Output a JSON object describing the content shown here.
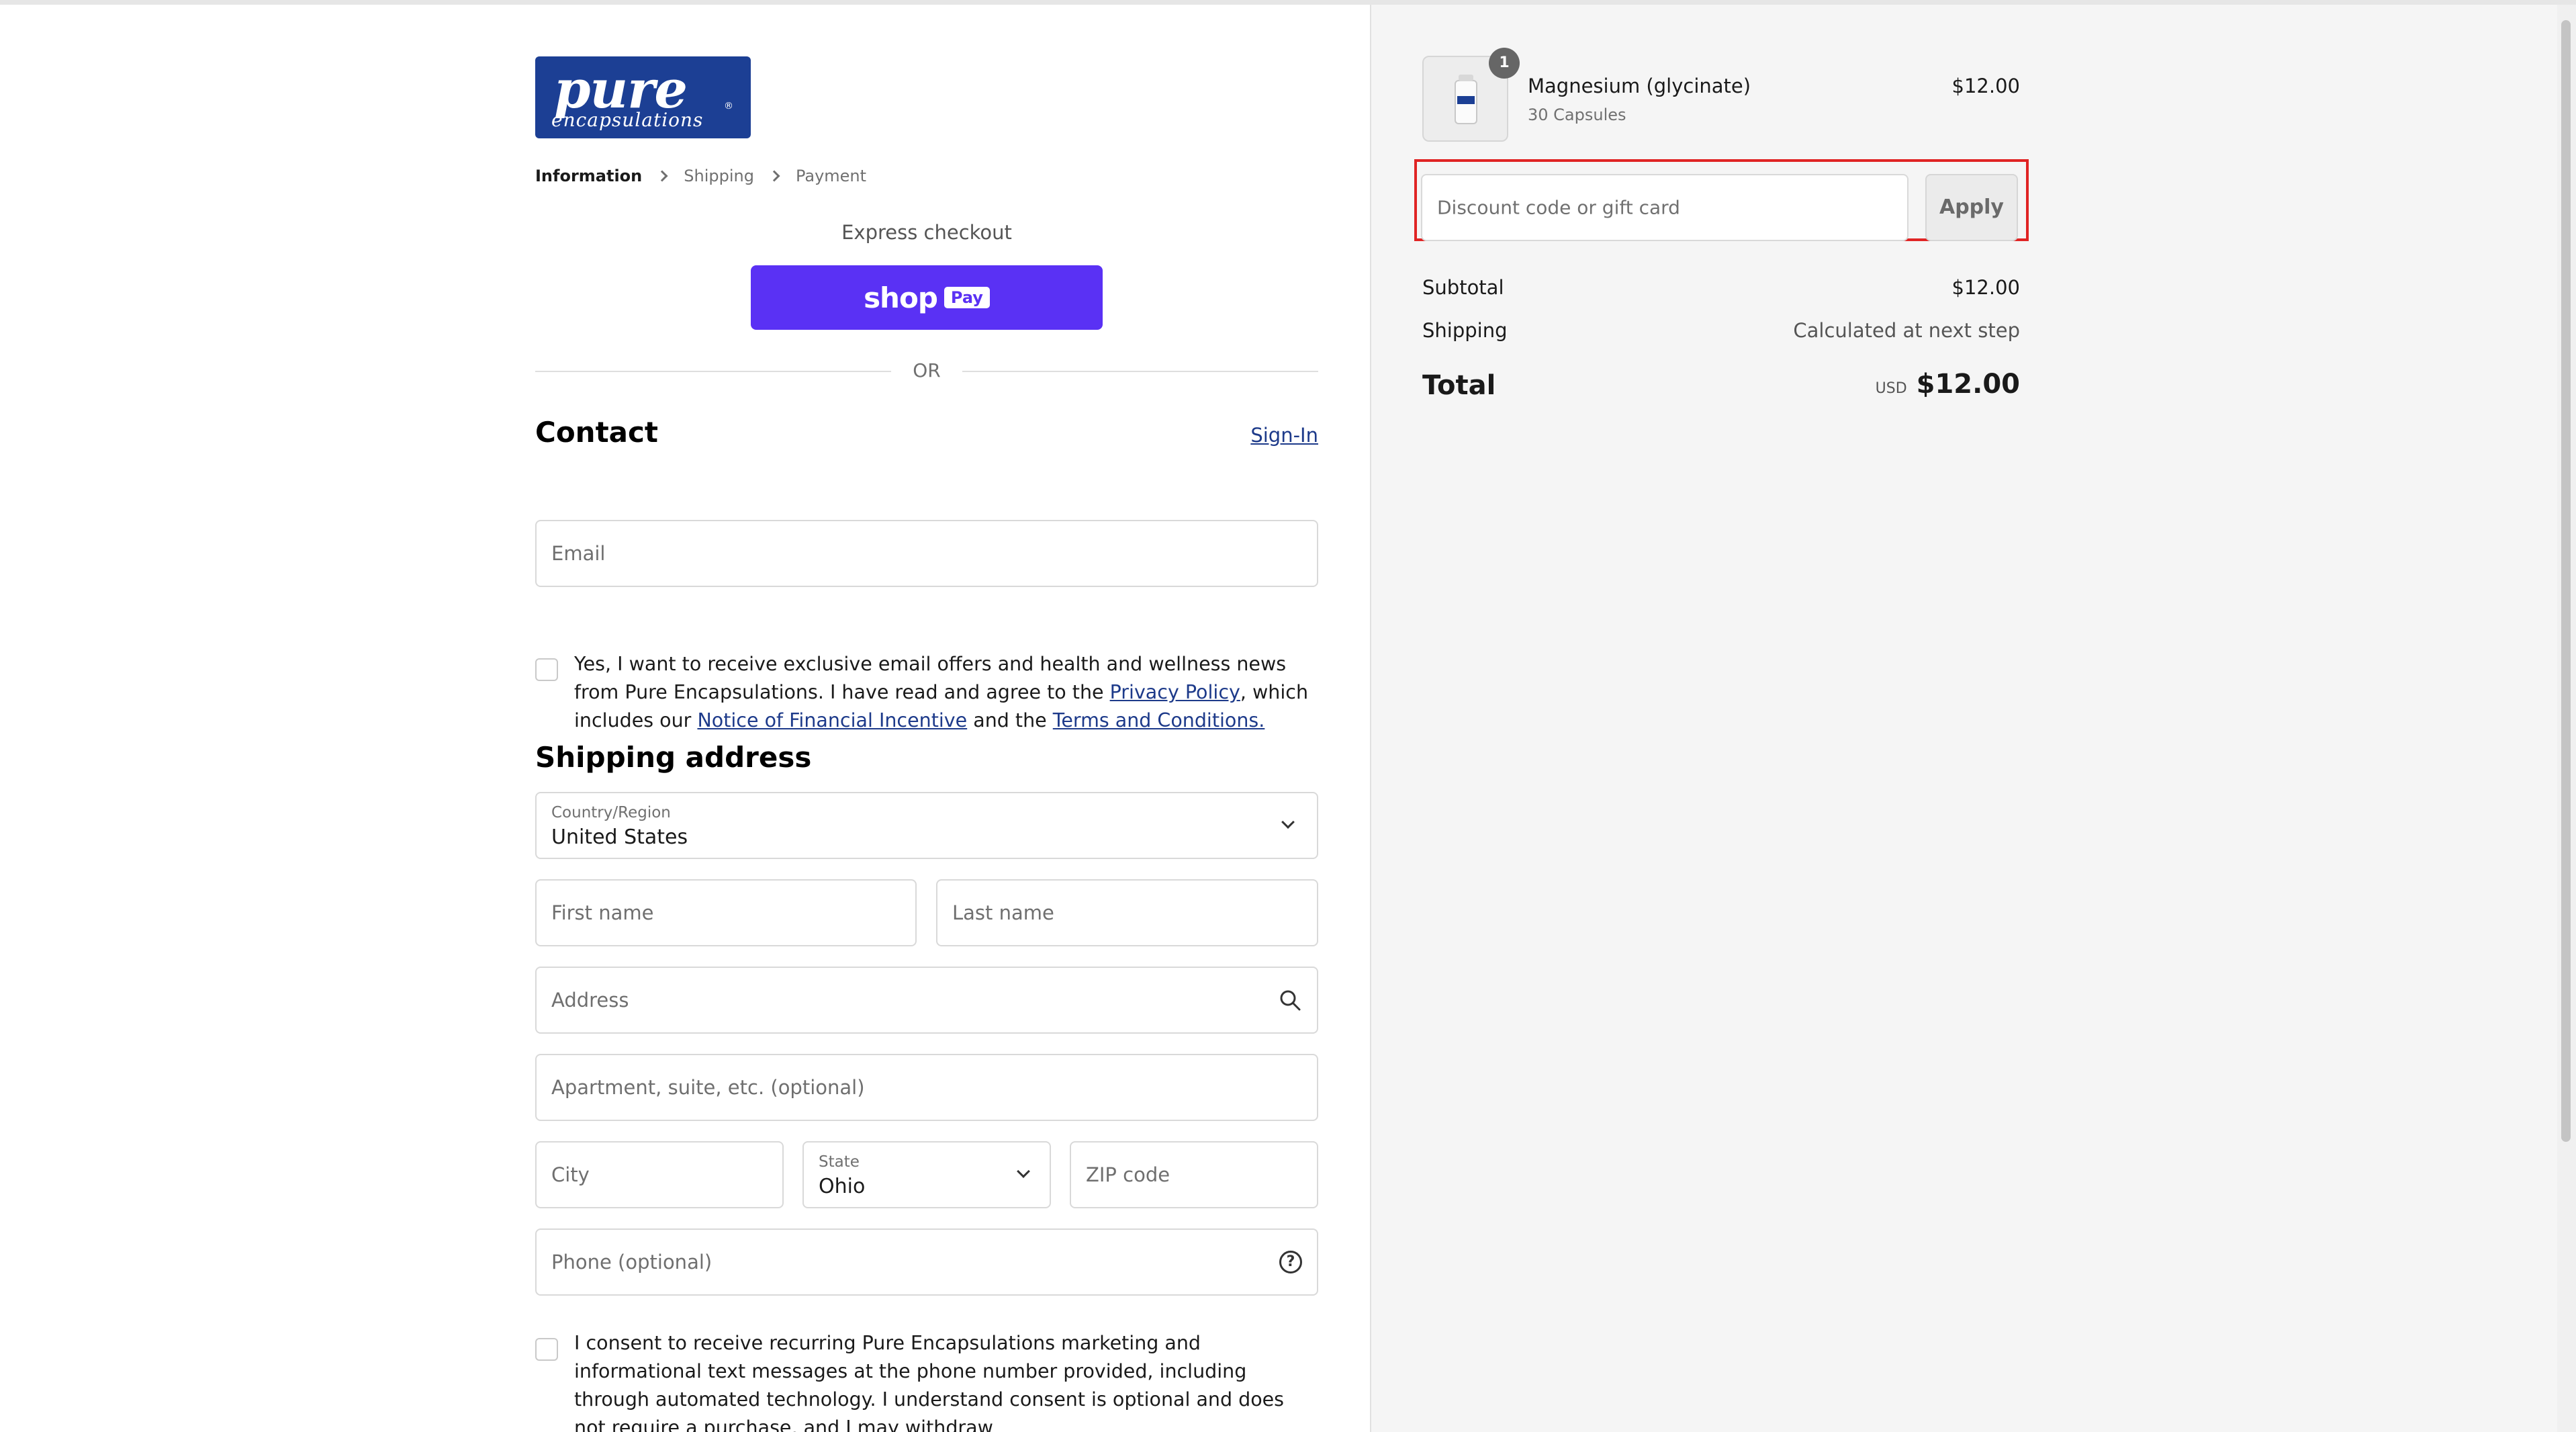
{
  "brand": {
    "logo_line1": "pure",
    "logo_line2": "encapsulations",
    "logo_reg": "®"
  },
  "breadcrumb": {
    "items": [
      "Information",
      "Shipping",
      "Payment"
    ]
  },
  "express": {
    "title": "Express checkout",
    "shop_pay_label": "shop",
    "shop_pay_tag": "Pay",
    "or_label": "OR"
  },
  "contact": {
    "title": "Contact",
    "sign_in": "Sign-In",
    "email_placeholder": "Email",
    "marketing_consent": {
      "text_1": "Yes, I want to receive exclusive email offers and health and wellness news from Pure Encapsulations. I have read and agree to the ",
      "privacy_link": "Privacy Policy",
      "text_2": ", which includes our ",
      "notice_link": "Notice of Financial Incentive",
      "text_3": " and the ",
      "terms_link": "Terms and Conditions.",
      "checked": false
    }
  },
  "shipping": {
    "title": "Shipping address",
    "country": {
      "label": "Country/Region",
      "value": "United States"
    },
    "first_name_placeholder": "First name",
    "last_name_placeholder": "Last name",
    "address_placeholder": "Address",
    "apartment_placeholder": "Apartment, suite, etc. (optional)",
    "city_placeholder": "City",
    "state": {
      "label": "State",
      "value": "Ohio"
    },
    "zip_placeholder": "ZIP code",
    "phone_placeholder": "Phone (optional)",
    "sms_consent_text": "I consent to receive recurring Pure Encapsulations marketing and informational text messages at the phone number provided, including through automated technology. I understand consent is optional and does not require a purchase, and I may withdraw"
  },
  "order": {
    "item": {
      "name": "Magnesium (glycinate)",
      "variant": "30 Capsules",
      "price": "$12.00",
      "quantity": "1"
    },
    "discount_placeholder": "Discount code or gift card",
    "apply_label": "Apply",
    "subtotal_label": "Subtotal",
    "subtotal_value": "$12.00",
    "shipping_label": "Shipping",
    "shipping_value": "Calculated at next step",
    "total_label": "Total",
    "currency": "USD",
    "total_value": "$12.00"
  },
  "colors": {
    "brand": "#1c3f94",
    "shop_pay": "#5a31f4",
    "link": "#1d3a8a",
    "highlight": "#e02424"
  }
}
